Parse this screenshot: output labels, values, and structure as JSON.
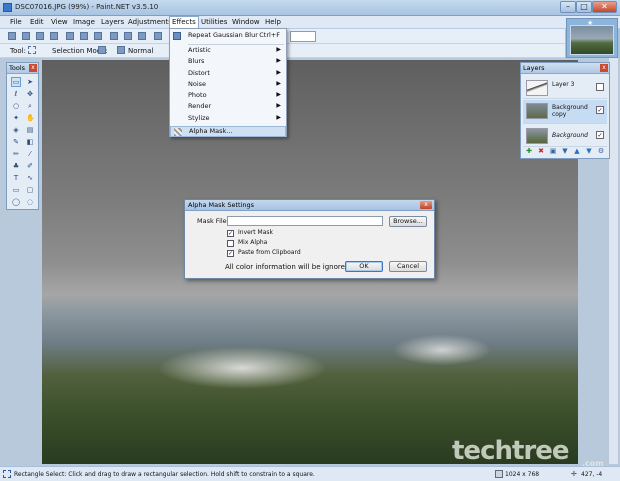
{
  "window": {
    "title": "DSC07016.JPG (99%) - Paint.NET v3.5.10"
  },
  "menu": [
    "File",
    "Edit",
    "View",
    "Image",
    "Layers",
    "Adjustments",
    "Effects",
    "Utilities",
    "Window",
    "Help"
  ],
  "toolbar": {
    "tool_label": "Tool:",
    "selection_mode_label": "Selection Mode:",
    "blend_mode": "Normal"
  },
  "tools_panel": {
    "title": "Tools",
    "close": "x"
  },
  "layers_panel": {
    "title": "Layers",
    "close": "x",
    "layers": [
      {
        "name": "Layer 3",
        "checked": ""
      },
      {
        "name": "Background copy",
        "checked": "✓"
      },
      {
        "name": "Background",
        "checked": "✓"
      }
    ]
  },
  "effects_menu": {
    "repeat": "Repeat Gaussian Blur",
    "repeat_shortcut": "Ctrl+F",
    "submenus": [
      "Artistic",
      "Blurs",
      "Distort",
      "Noise",
      "Photo",
      "Render",
      "Stylize"
    ],
    "highlighted": "Alpha Mask...",
    "arrow": "▶"
  },
  "dialog": {
    "title": "Alpha Mask Settings",
    "close": "x",
    "mask_file_label": "Mask File:",
    "mask_file_value": "",
    "browse": "Browse...",
    "options": [
      {
        "label": "Invert Mask",
        "checked": "✓"
      },
      {
        "label": "Mix Alpha",
        "checked": ""
      },
      {
        "label": "Paste from Clipboard",
        "checked": "✓"
      }
    ],
    "note": "All color information will be ignored.",
    "ok": "OK",
    "cancel": "Cancel"
  },
  "status": {
    "hint": "Rectangle Select: Click and drag to draw a rectangular selection. Hold shift to constrain to a square.",
    "dimensions": "1024 x 768",
    "coords": "427, -4"
  },
  "watermark": {
    "main": "techtree",
    "suffix": ".com"
  }
}
